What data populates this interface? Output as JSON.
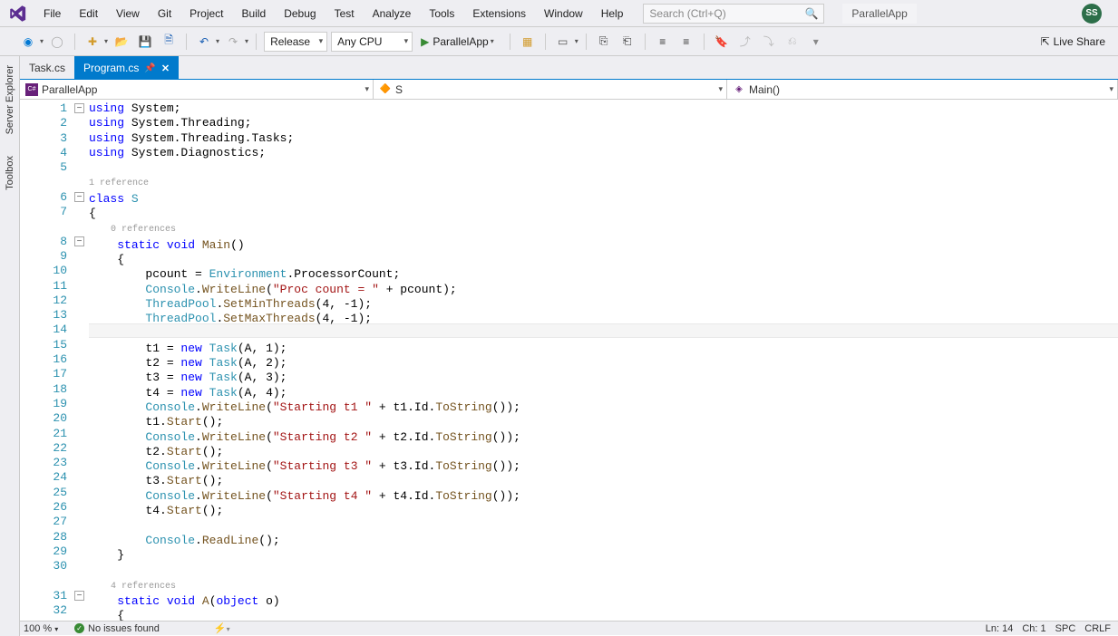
{
  "menu": {
    "items": [
      "File",
      "Edit",
      "View",
      "Git",
      "Project",
      "Build",
      "Debug",
      "Test",
      "Analyze",
      "Tools",
      "Extensions",
      "Window",
      "Help"
    ],
    "search_placeholder": "Search (Ctrl+Q)",
    "solution_name": "ParallelApp",
    "avatar": "SS"
  },
  "toolbar": {
    "config": "Release",
    "platform": "Any CPU",
    "start_label": "ParallelApp",
    "live_share": "Live Share"
  },
  "side": {
    "server_explorer": "Server Explorer",
    "toolbox": "Toolbox"
  },
  "tabs": {
    "inactive": "Task.cs",
    "active": "Program.cs"
  },
  "nav": {
    "project": "ParallelApp",
    "class": "S",
    "method": "Main()"
  },
  "code": {
    "ref1": "1 reference",
    "ref0": "0 references",
    "ref4": "4 references",
    "lines": [
      {
        "n": 1,
        "html": "<span class='kw'>using</span> System;"
      },
      {
        "n": 2,
        "html": "<span class='kw'>using</span> System.Threading;"
      },
      {
        "n": 3,
        "html": "<span class='kw'>using</span> System.Threading.Tasks;"
      },
      {
        "n": 4,
        "html": "<span class='kw'>using</span> System.Diagnostics;"
      },
      {
        "n": 5,
        "html": ""
      },
      {
        "ref": "ref1"
      },
      {
        "n": 6,
        "html": "<span class='kw'>class</span> <span class='type'>S</span>"
      },
      {
        "n": 7,
        "html": "{"
      },
      {
        "ref": "ref0",
        "pad": "    "
      },
      {
        "n": 8,
        "html": "    <span class='kw'>static</span> <span class='kw'>void</span> <span class='method'>Main</span>()"
      },
      {
        "n": 9,
        "html": "    {"
      },
      {
        "n": 10,
        "html": "        pcount = <span class='type'>Environment</span>.ProcessorCount;"
      },
      {
        "n": 11,
        "html": "        <span class='type'>Console</span>.<span class='method'>WriteLine</span>(<span class='str'>\"Proc count = \"</span> + pcount);"
      },
      {
        "n": 12,
        "html": "        <span class='type'>ThreadPool</span>.<span class='method'>SetMinThreads</span>(4, -1);"
      },
      {
        "n": 13,
        "html": "        <span class='type'>ThreadPool</span>.<span class='method'>SetMaxThreads</span>(4, -1);"
      },
      {
        "n": 14,
        "html": ""
      },
      {
        "n": 15,
        "html": "        t1 = <span class='kw'>new</span> <span class='type'>Task</span>(A, 1);"
      },
      {
        "n": 16,
        "html": "        t2 = <span class='kw'>new</span> <span class='type'>Task</span>(A, 2);"
      },
      {
        "n": 17,
        "html": "        t3 = <span class='kw'>new</span> <span class='type'>Task</span>(A, 3);"
      },
      {
        "n": 18,
        "html": "        t4 = <span class='kw'>new</span> <span class='type'>Task</span>(A, 4);"
      },
      {
        "n": 19,
        "html": "        <span class='type'>Console</span>.<span class='method'>WriteLine</span>(<span class='str'>\"Starting t1 \"</span> + t1.Id.<span class='method'>ToString</span>());"
      },
      {
        "n": 20,
        "html": "        t1.<span class='method'>Start</span>();"
      },
      {
        "n": 21,
        "html": "        <span class='type'>Console</span>.<span class='method'>WriteLine</span>(<span class='str'>\"Starting t2 \"</span> + t2.Id.<span class='method'>ToString</span>());"
      },
      {
        "n": 22,
        "html": "        t2.<span class='method'>Start</span>();"
      },
      {
        "n": 23,
        "html": "        <span class='type'>Console</span>.<span class='method'>WriteLine</span>(<span class='str'>\"Starting t3 \"</span> + t3.Id.<span class='method'>ToString</span>());"
      },
      {
        "n": 24,
        "html": "        t3.<span class='method'>Start</span>();"
      },
      {
        "n": 25,
        "html": "        <span class='type'>Console</span>.<span class='method'>WriteLine</span>(<span class='str'>\"Starting t4 \"</span> + t4.Id.<span class='method'>ToString</span>());"
      },
      {
        "n": 26,
        "html": "        t4.<span class='method'>Start</span>();"
      },
      {
        "n": 27,
        "html": ""
      },
      {
        "n": 28,
        "html": "        <span class='type'>Console</span>.<span class='method'>ReadLine</span>();"
      },
      {
        "n": 29,
        "html": "    }"
      },
      {
        "n": 30,
        "html": ""
      },
      {
        "ref": "ref4",
        "pad": "    "
      },
      {
        "n": 31,
        "html": "    <span class='kw'>static</span> <span class='kw'>void</span> <span class='method'>A</span>(<span class='kw'>object</span> o)"
      },
      {
        "n": 32,
        "html": "    {"
      }
    ],
    "highlight_row": 15
  },
  "status": {
    "zoom": "100 %",
    "issues": "No issues found",
    "ln": "Ln: 14",
    "ch": "Ch: 1",
    "spc": "SPC",
    "crlf": "CRLF"
  }
}
